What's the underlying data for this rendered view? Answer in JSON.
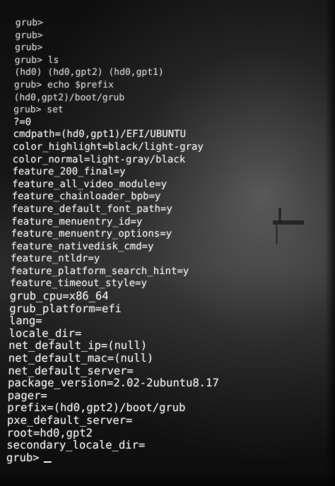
{
  "terminal": {
    "lines": [
      "grub>",
      "grub>",
      "grub>",
      "grub> ls",
      "(hd0) (hd0,gpt2) (hd0,gpt1)",
      "grub> echo $prefix",
      "(hd0,gpt2)/boot/grub",
      "grub> set",
      "?=0",
      "cmdpath=(hd0,gpt1)/EFI/UBUNTU",
      "color_highlight=black/light-gray",
      "color_normal=light-gray/black",
      "feature_200_final=y",
      "feature_all_video_module=y",
      "feature_chainloader_bpb=y",
      "feature_default_font_path=y",
      "feature_menuentry_id=y",
      "feature_menuentry_options=y",
      "feature_nativedisk_cmd=y",
      "feature_ntldr=y",
      "feature_platform_search_hint=y",
      "feature_timeout_style=y",
      "grub_cpu=x86_64",
      "grub_platform=efi",
      "lang=",
      "locale_dir=",
      "net_default_ip=(null)",
      "net_default_mac=(null)",
      "net_default_server=",
      "package_version=2.02-2ubuntu8.17",
      "pager=",
      "prefix=(hd0,gpt2)/boot/grub",
      "pxe_default_server=",
      "root=hd0,gpt2",
      "secondary_locale_dir="
    ],
    "prompt": "grub>"
  },
  "colors": {
    "text": "#e9e9e9",
    "background": "#111111"
  }
}
